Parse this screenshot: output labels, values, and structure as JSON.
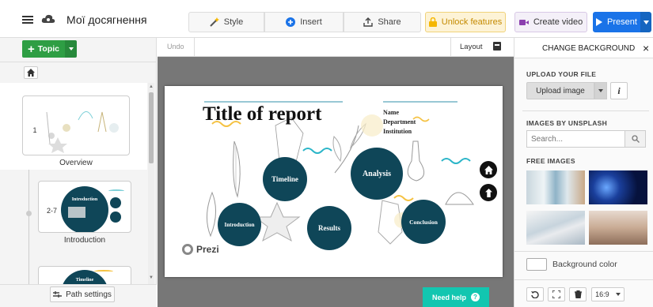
{
  "header": {
    "title": "Мої досягнення",
    "style_label": "Style",
    "insert_label": "Insert",
    "share_label": "Share",
    "unlock_label": "Unlock features",
    "create_video_label": "Create video",
    "present_label": "Present"
  },
  "toolbar": {
    "topic_label": "Topic",
    "undo_label": "Undo",
    "layout_label": "Layout"
  },
  "sidebar": {
    "overview_label": "Overview",
    "overview_number": "1",
    "introduction_label": "Introduction",
    "introduction_range": "2-7",
    "thumb_intro_text": "Introduction",
    "thumb_timeline_text": "Timeline",
    "path_settings_label": "Path settings"
  },
  "slide": {
    "title": "Title of report",
    "meta": [
      "Name",
      "Department",
      "Institution"
    ],
    "topics": {
      "timeline": "Timeline",
      "analysis": "Analysis",
      "introduction": "Introduction",
      "results": "Results",
      "conclusion": "Conclusion"
    },
    "brand": "Prezi"
  },
  "help_label": "Need help",
  "right_panel": {
    "title": "CHANGE BACKGROUND",
    "upload_heading": "UPLOAD YOUR FILE",
    "upload_button": "Upload image",
    "info_label": "i",
    "unsplash_heading": "IMAGES BY UNSPLASH",
    "search_placeholder": "Search...",
    "free_heading": "FREE IMAGES",
    "background_color_label": "Background color",
    "aspect_ratio": "16:9"
  },
  "colors": {
    "accent_green": "#2e9e44",
    "present_blue": "#1a73e8",
    "unlock_yellow": "#f5b700",
    "topic_navy": "#0f4658",
    "help_teal": "#12c6b0"
  }
}
